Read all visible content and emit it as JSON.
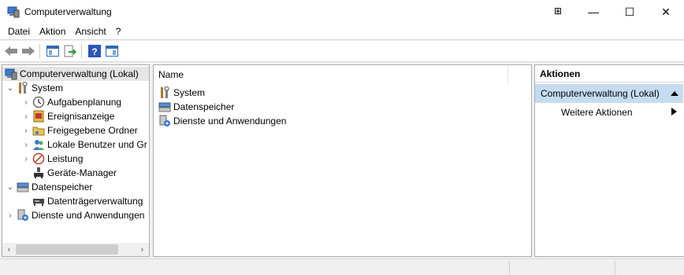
{
  "window": {
    "title": "Computerverwaltung",
    "buttons": {
      "snap": "⊞",
      "minimize": "—",
      "maximize": "☐",
      "close": "✕"
    }
  },
  "menu": [
    "Datei",
    "Aktion",
    "Ansicht",
    "?"
  ],
  "tree": {
    "root": "Computerverwaltung (Lokal)",
    "system": "System",
    "system_children": [
      "Aufgabenplanung",
      "Ereignisanzeige",
      "Freigegebene Ordner",
      "Lokale Benutzer und Gr",
      "Leistung",
      "Geräte-Manager"
    ],
    "storage": "Datenspeicher",
    "storage_children": [
      "Datenträgerverwaltung"
    ],
    "services": "Dienste und Anwendungen"
  },
  "list": {
    "column_name": "Name",
    "items": [
      "System",
      "Datenspeicher",
      "Dienste und Anwendungen"
    ]
  },
  "actions": {
    "header": "Aktionen",
    "group": "Computerverwaltung (Lokal)",
    "more": "Weitere Aktionen"
  },
  "icons": [
    "computer-icon",
    "system-tools-icon",
    "clock-icon",
    "event-viewer-icon",
    "shared-folder-icon",
    "users-icon",
    "performance-icon",
    "device-manager-icon",
    "storage-icon",
    "disk-icon",
    "services-icon"
  ],
  "colors": {
    "selection": "#e5e5e5",
    "action_group": "#c5dcf0"
  }
}
